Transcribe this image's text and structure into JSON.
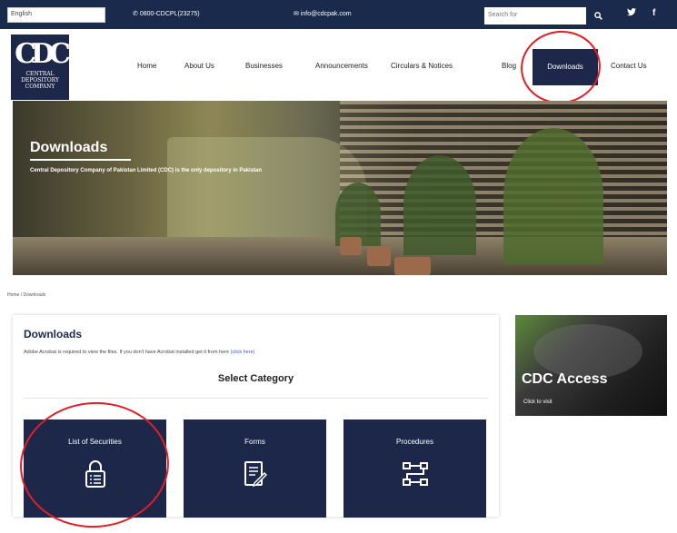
{
  "topbar": {
    "language": "English",
    "phone": "0800-CDCPL(23275)",
    "email": "info@cdcpak.com",
    "search_placeholder": "Search for",
    "search_icon": "search-icon",
    "twitter_icon": "twitter-icon",
    "facebook_icon": "facebook-icon"
  },
  "logo": {
    "mark": "CDC",
    "lines": [
      "CENTRAL",
      "DEPOSITORY",
      "COMPANY"
    ]
  },
  "nav": {
    "items": [
      "Home",
      "About Us",
      "Businesses",
      "Announcements",
      "Circulars & Notices",
      "Blog",
      "Downloads",
      "Contact Us"
    ],
    "active": "Downloads"
  },
  "banner": {
    "title": "Downloads",
    "subtitle": "Central Depository Company of Pakistan Limited (CDC) is the only depository in Pakistan"
  },
  "breadcrumb": "Home / Downloads",
  "downloads": {
    "title": "Downloads",
    "note": "Adobe Acrobat is required to view the files. If you don't have Acrobat installed get it from here",
    "note_link": "(click here)",
    "select_category": "Select Category",
    "tiles": [
      {
        "label": "List of Securities",
        "icon": "lock-list-icon"
      },
      {
        "label": "Forms",
        "icon": "document-edit-icon"
      },
      {
        "label": "Procedures",
        "icon": "process-flow-icon"
      }
    ]
  },
  "promo": {
    "title": "CDC Access",
    "subtitle": "Click to visit"
  },
  "colors": {
    "navy": "#1c2749",
    "topbar": "#192a4c",
    "highlight_red": "#e21f26",
    "link_blue": "#3b5bb8"
  }
}
